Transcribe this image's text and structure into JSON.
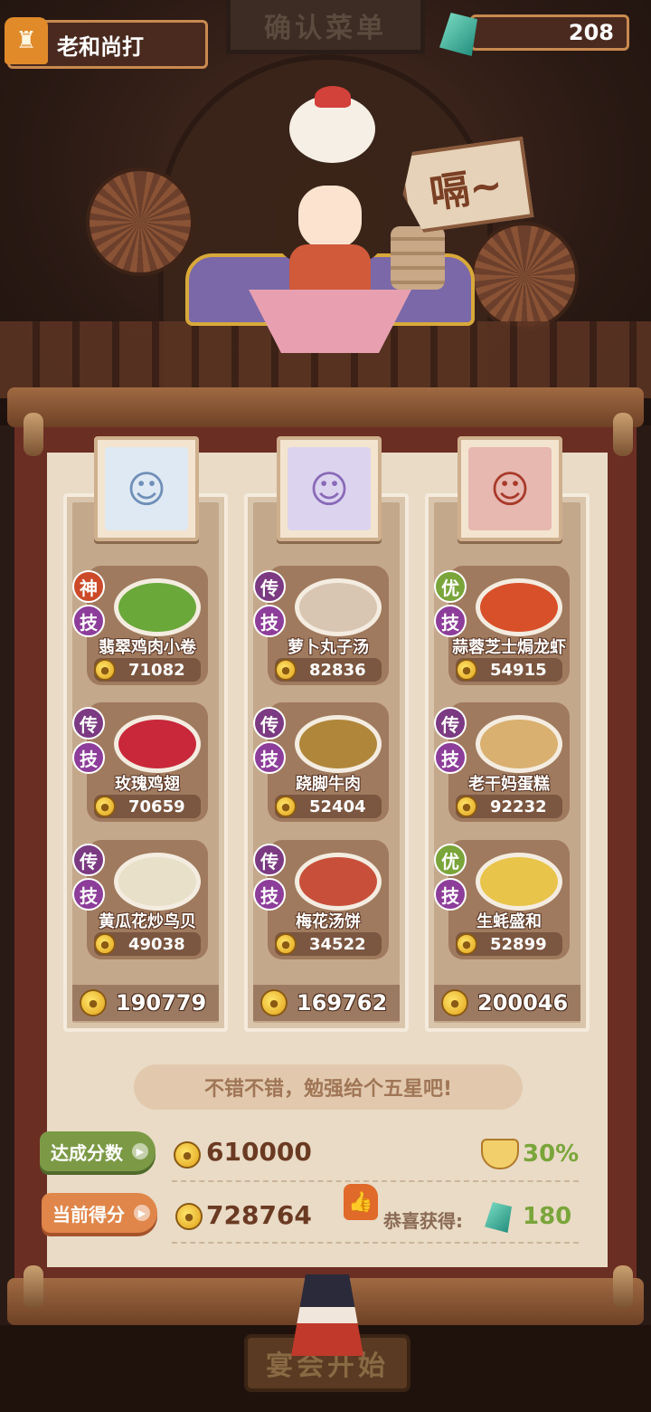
{
  "header": {
    "title": "确认菜单",
    "player_name": "老和尚打",
    "gems": "208"
  },
  "speech_sign": "嗝~",
  "chefs": [
    {
      "portrait": "chef-1",
      "dishes": [
        {
          "grade": "神",
          "skill": "技",
          "name": "翡翠鸡肉小卷",
          "price": "71082"
        },
        {
          "grade": "传",
          "skill": "技",
          "name": "玫瑰鸡翅",
          "price": "70659"
        },
        {
          "grade": "传",
          "skill": "技",
          "name": "黄瓜花炒鸟贝",
          "price": "49038"
        }
      ],
      "total": "190779"
    },
    {
      "portrait": "chef-2",
      "dishes": [
        {
          "grade": "传",
          "skill": "技",
          "name": "萝卜丸子汤",
          "price": "82836"
        },
        {
          "grade": "传",
          "skill": "技",
          "name": "跷脚牛肉",
          "price": "52404"
        },
        {
          "grade": "传",
          "skill": "技",
          "name": "梅花汤饼",
          "price": "34522"
        }
      ],
      "total": "169762"
    },
    {
      "portrait": "chef-3",
      "dishes": [
        {
          "grade": "优",
          "skill": "技",
          "name": "蒜蓉芝士焗龙虾",
          "price": "54915"
        },
        {
          "grade": "传",
          "skill": "技",
          "name": "老干妈蛋糕",
          "price": "92232"
        },
        {
          "grade": "优",
          "skill": "技",
          "name": "生蚝盛和",
          "price": "52899"
        }
      ],
      "total": "200046"
    }
  ],
  "comment": "不错不错，勉强给个五星吧!",
  "target": {
    "label": "达成分数",
    "value": "610000",
    "percent": "30%"
  },
  "current": {
    "label": "当前得分",
    "value": "728764",
    "reward_label": "恭喜获得:",
    "reward_value": "180"
  },
  "start_button": "宴会开始",
  "colors": {
    "grade_shen": "#cc4a2a",
    "grade_chuan": "#7b3a82",
    "grade_you": "#7aa53a",
    "target_tag": "#7c9a46",
    "current_tag": "#e0864a"
  }
}
